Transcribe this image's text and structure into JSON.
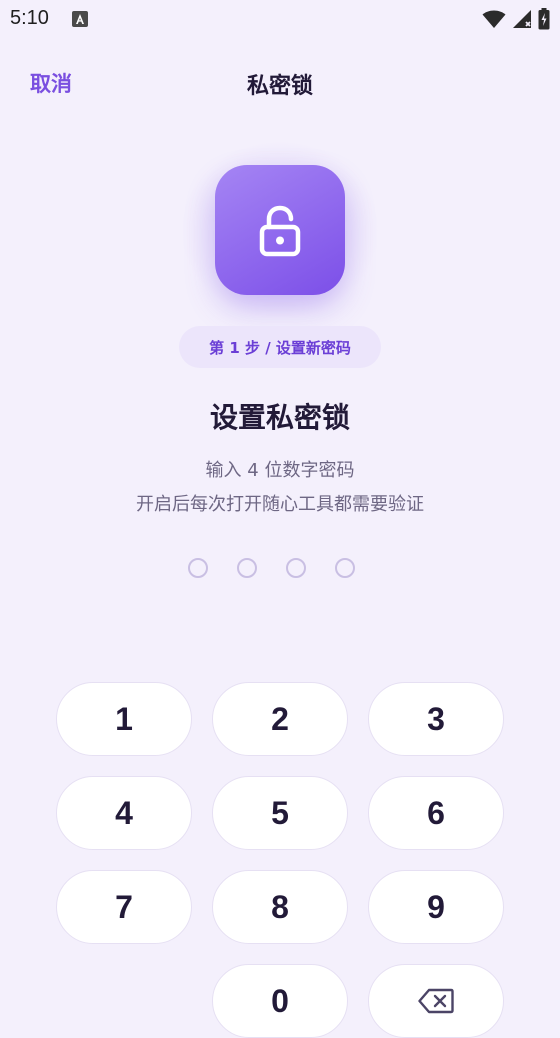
{
  "status_bar": {
    "time": "5:10"
  },
  "header": {
    "cancel_label": "取消",
    "title": "私密锁"
  },
  "step_label": "第 1 步 / 设置新密码",
  "heading": "设置私密锁",
  "subtitle_line1": "输入 4 位数字密码",
  "subtitle_line2": "开启后每次打开随心工具都需要验证",
  "pin": {
    "length": 4,
    "filled": 0
  },
  "keypad": {
    "k1": "1",
    "k2": "2",
    "k3": "3",
    "k4": "4",
    "k5": "5",
    "k6": "6",
    "k7": "7",
    "k8": "8",
    "k9": "9",
    "k0": "0"
  },
  "colors": {
    "accent": "#7a4fe0",
    "background": "#f4f0fc",
    "lock_gradient_start": "#a585f4",
    "lock_gradient_end": "#7c4fe8"
  }
}
